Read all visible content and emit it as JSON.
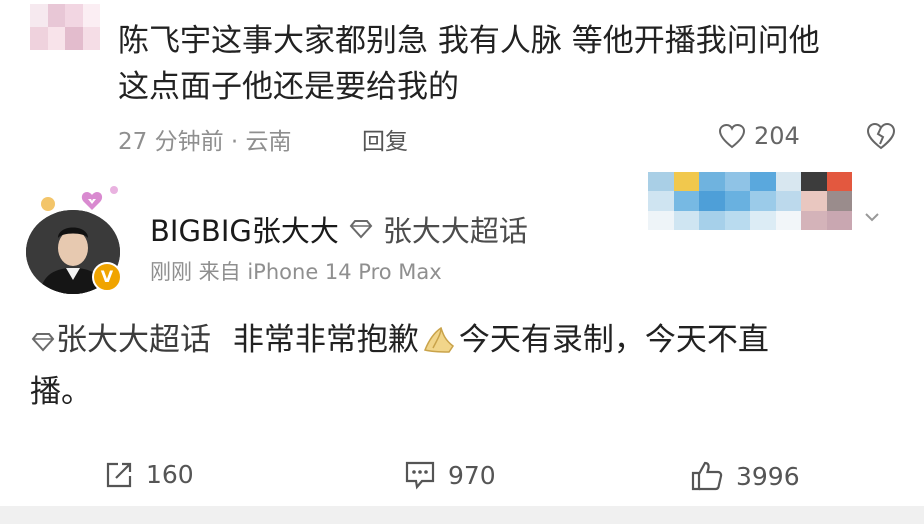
{
  "comment": {
    "text_line1": "陈飞宇这事大家都别急 我有人脉 等他开播我问问他",
    "text_line2": "这点面子他还是要给我的",
    "time_location": "27 分钟前 · 云南",
    "reply_label": "回复",
    "like_count": "204"
  },
  "post": {
    "username": "BIGBIG张大大",
    "super_topic": "张大大超话",
    "posted": "刚刚  来自 iPhone 14 Pro Max",
    "body_topic": "张大大超话",
    "body_text_part1": "非常非常抱歉",
    "body_text_part2": "今天有录制，今天不直",
    "body_text_part3": "播。"
  },
  "footer": {
    "repost_count": "160",
    "comment_count": "970",
    "like_count": "3996"
  },
  "colors": {
    "accent_orange": "#f0a400",
    "text_gray": "#8f8f8f"
  },
  "icons": [
    "heart-icon",
    "broken-heart-icon",
    "diamond-topic-icon",
    "pray-hands-icon",
    "repost-icon",
    "comment-icon",
    "thumbs-up-icon",
    "chevron-down-icon",
    "verified-v-icon"
  ]
}
